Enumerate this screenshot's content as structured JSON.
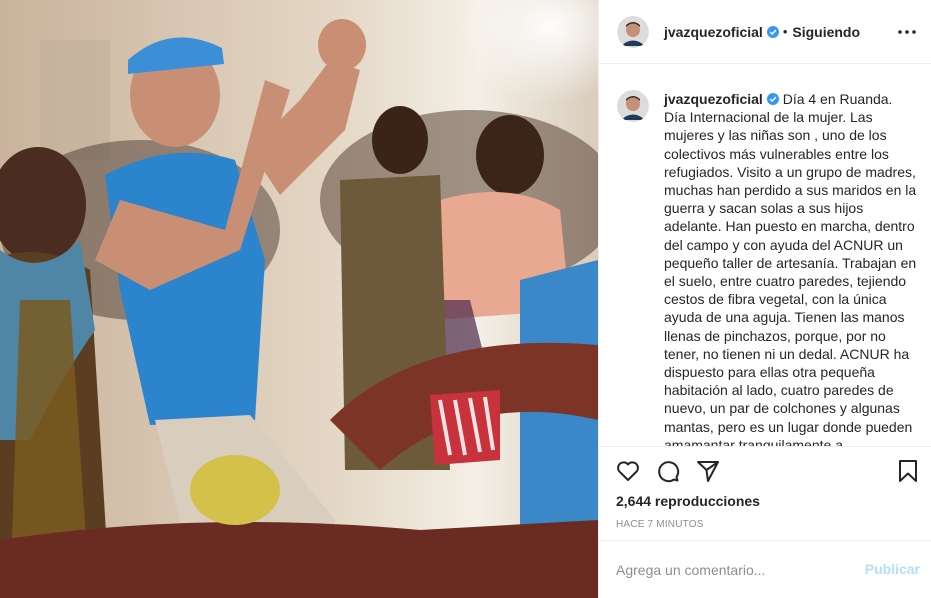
{
  "post": {
    "username": "jvazquezoficial",
    "separator": "•",
    "follow_status": "Siguiendo",
    "verified": true,
    "caption": "Día 4 en Ruanda. Día Internacional de la mujer. Las mujeres y las niñas son , uno de los colectivos más vulnerables entre los refugiados. Visito a un grupo de madres, muchas han perdido a sus maridos en la guerra y sacan solas a sus hijos adelante. Han puesto en marcha, dentro del campo y con ayuda del ACNUR un pequeño taller de artesanía. Trabajan en el suelo, entre cuatro paredes, tejiendo cestos de fibra vegetal, con la única ayuda de una aguja. Tienen las manos llenas de pinchazos, porque, por no tener, no tienen ni un dedal. ACNUR ha dispuesto para ellas otra pequeña habitación al lado, cuatro paredes de nuevo, un par de colchones y algunas mantas, pero es un lugar donde pueden amamantar tranquilamente a",
    "views": "2,644 reproducciones",
    "time_ago": "HACE 7 MINUTOS"
  },
  "comment": {
    "placeholder": "Agrega un comentario...",
    "publish_label": "Publicar"
  },
  "icons": {
    "more": "more-options-icon",
    "like": "heart-icon",
    "comment": "comment-icon",
    "share": "share-icon",
    "save": "bookmark-icon",
    "verified": "verified-badge-icon"
  },
  "colors": {
    "verified_blue": "#3897f0",
    "publish_disabled": "#b2dffc",
    "secondary_text": "#8e8e8e",
    "primary_text": "#262626",
    "divider": "#efefef"
  }
}
